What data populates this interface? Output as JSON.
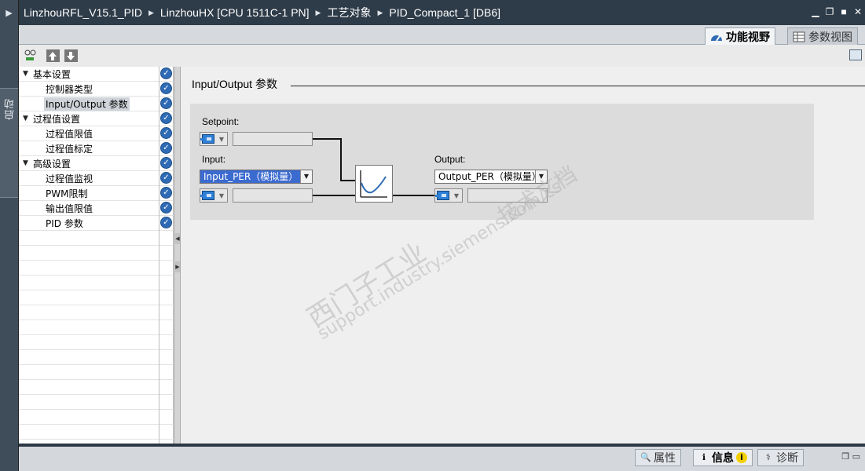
{
  "breadcrumb": [
    "LinzhouRFL_V15.1_PID",
    "LinzhouHX [CPU 1511C-1 PN]",
    "工艺对象",
    "PID_Compact_1 [DB6]"
  ],
  "side_strip": {
    "label": "启动"
  },
  "view_tabs": {
    "functional_view": "功能视野",
    "parameter_view": "参数视图"
  },
  "tree": {
    "items": [
      {
        "label": "基本设置",
        "level": 0,
        "expanded": true
      },
      {
        "label": "控制器类型",
        "level": 1
      },
      {
        "label": "Input/Output 参数",
        "level": 1,
        "selected": true
      },
      {
        "label": "过程值设置",
        "level": 0,
        "expanded": true
      },
      {
        "label": "过程值限值",
        "level": 1
      },
      {
        "label": "过程值标定",
        "level": 1
      },
      {
        "label": "高级设置",
        "level": 0,
        "expanded": true
      },
      {
        "label": "过程值监视",
        "level": 1
      },
      {
        "label": "PWM限制",
        "level": 1
      },
      {
        "label": "输出值限值",
        "level": 1
      },
      {
        "label": "PID 参数",
        "level": 1
      }
    ]
  },
  "main": {
    "section_title": "Input/Output 参数",
    "setpoint_label": "Setpoint:",
    "input_label": "Input:",
    "input_select": "Input_PER（模拟量）",
    "output_label": "Output:",
    "output_select": "Output_PER（模拟量）"
  },
  "watermark": {
    "line1": "西门子工业",
    "line2": "support.industry.siemens.com/cs",
    "line3": "技术文档"
  },
  "bottom_tabs": {
    "properties": "属性",
    "info": "信息",
    "diagnostics": "诊断"
  },
  "colors": {
    "title_bar": "#2e3b48",
    "check": "#2f6bb5",
    "selected_dropdown": "#3c6bd0"
  }
}
